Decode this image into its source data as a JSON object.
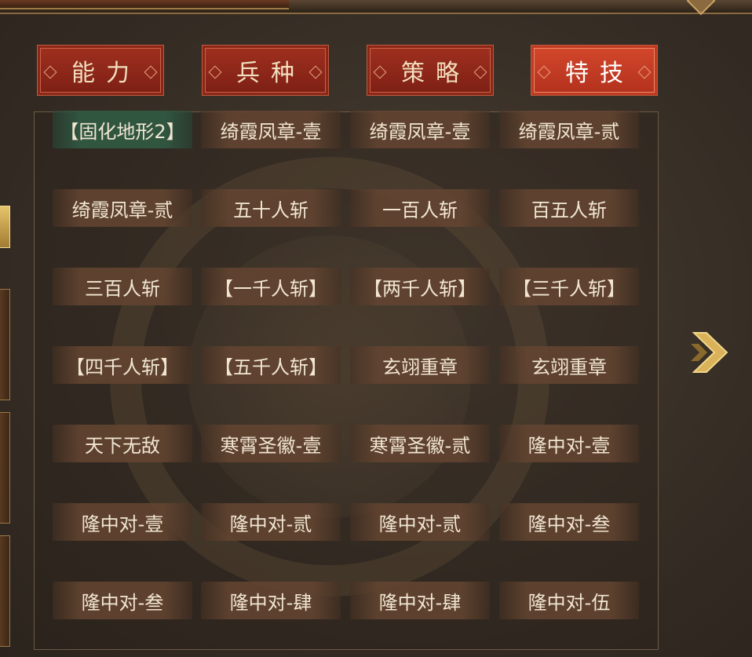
{
  "tabs": [
    {
      "label": "能力",
      "active": false
    },
    {
      "label": "兵种",
      "active": false
    },
    {
      "label": "策略",
      "active": false
    },
    {
      "label": "特技",
      "active": true
    }
  ],
  "skills": [
    [
      "【固化地形2】",
      "绮霞凤章-壹",
      "绮霞凤章-壹",
      "绮霞凤章-贰"
    ],
    [
      "绮霞凤章-贰",
      "五十人斩",
      "一百人斩",
      "百五人斩"
    ],
    [
      "三百人斩",
      "【一千人斩】",
      "【两千人斩】",
      "【三千人斩】"
    ],
    [
      "【四千人斩】",
      "【五千人斩】",
      "玄翊重章",
      "玄翊重章"
    ],
    [
      "天下无敌",
      "寒霄圣徽-壹",
      "寒霄圣徽-贰",
      "隆中对-壹"
    ],
    [
      "隆中对-壹",
      "隆中对-贰",
      "隆中对-贰",
      "隆中对-叁"
    ],
    [
      "隆中对-叁",
      "隆中对-肆",
      "隆中对-肆",
      "隆中对-伍"
    ]
  ],
  "selected_skill": "【固化地形2】",
  "icons": {
    "next_page": "double-chevron-right-icon"
  },
  "colors": {
    "tab_active": "#c43c24",
    "tab_inactive": "#8a2a1a",
    "cell_bg": "#5e4230",
    "cell_selected": "#305842",
    "gold": "#d9b25a"
  }
}
